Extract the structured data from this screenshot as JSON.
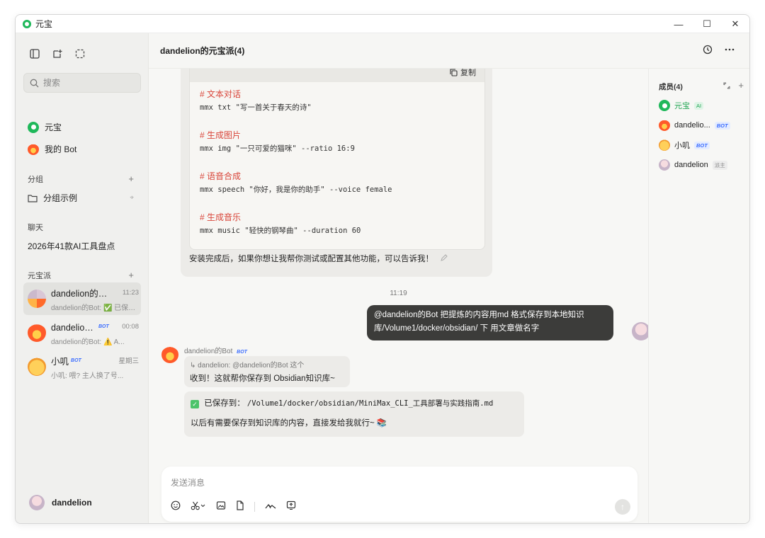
{
  "window": {
    "title": "元宝",
    "minimize": "—",
    "maximize": "☐",
    "close": "✕"
  },
  "sidebar": {
    "search_placeholder": "搜索",
    "pinned": [
      {
        "label": "元宝"
      },
      {
        "label": "我的 Bot"
      }
    ],
    "groups_section": {
      "label": "分组",
      "add": "+"
    },
    "group_item": {
      "label": "分组示例",
      "pin": "⌖"
    },
    "chat_section": {
      "label": "聊天"
    },
    "chat_item": {
      "label": "2026年41款AI工具盘点"
    },
    "yuanbao_section": {
      "label": "元宝派",
      "add": "+"
    },
    "conversations": [
      {
        "name": "dandelion的元宝派(4)",
        "time": "11:23",
        "preview": "dandelion的Bot: ✅ 已保存到",
        "bot": ""
      },
      {
        "name": "dandelion的Bot",
        "time": "00:08",
        "preview": "dandelion的Bot: ⚠️ A...",
        "bot": "BOT"
      },
      {
        "name": "小叽",
        "time": "星期三",
        "preview": "小叽: 喂? 主人换了号...",
        "bot": "BOT"
      }
    ],
    "user": {
      "name": "dandelion"
    }
  },
  "header": {
    "title": "dandelion的元宝派(4)"
  },
  "chat": {
    "code_block": {
      "copy_label": "复制",
      "sections": [
        {
          "comment": "# 文本对话",
          "command": "mmx txt \"写一首关于春天的诗\""
        },
        {
          "comment": "# 生成图片",
          "command": "mmx img \"一只可爱的猫咪\" --ratio 16:9"
        },
        {
          "comment": "# 语音合成",
          "command": "mmx speech \"你好，我是你的助手\" --voice female"
        },
        {
          "comment": "# 生成音乐",
          "command": "mmx music \"轻快的钢琴曲\" --duration 60"
        }
      ]
    },
    "after_note": "安装完成后，如果你想让我帮你测试或配置其他功能，可以告诉我！",
    "timestamp": "11:19",
    "user_message": {
      "line1": "@dandelion的Bot   把提炼的内容用md 格式保存到本地知识",
      "line2": "库/Volume1/docker/obsidian/ 下 用文章做名字"
    },
    "bot_name": "dandelion的Bot",
    "bot_tag": "BOT",
    "reply_quote": "↳ dandelion: @dandelion的Bot 这个",
    "reply_text": "收到！这就帮你保存到 Obsidian知识库~",
    "saved_prefix": "已保存到：",
    "saved_path": "/Volume1/docker/obsidian/MiniMax_CLI_工具部署与实践指南.md",
    "saved_note": "以后有需要保存到知识库的内容，直接发给我就行~ 📚"
  },
  "composer": {
    "placeholder": "发送消息",
    "send": "↑"
  },
  "members": {
    "title": "成员(4)",
    "list": [
      {
        "name": "元宝",
        "tag": "AI"
      },
      {
        "name": "dandelio...",
        "tag": "BOT"
      },
      {
        "name": "小叽",
        "tag": "BOT"
      },
      {
        "name": "dandelion",
        "tag": "派主"
      }
    ]
  }
}
